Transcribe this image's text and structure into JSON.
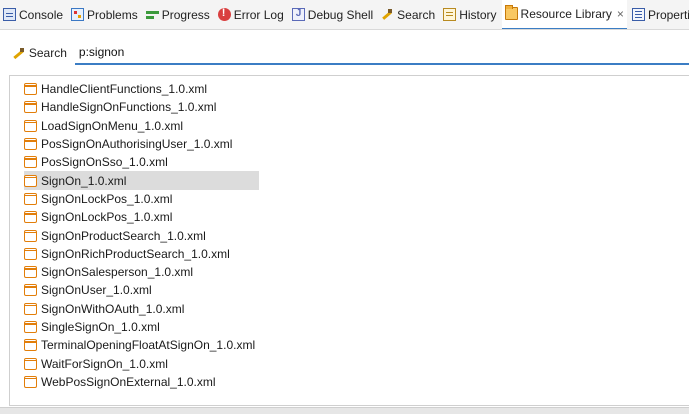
{
  "tabs": [
    {
      "label": "Console",
      "icon": "console-icon",
      "active": false
    },
    {
      "label": "Problems",
      "icon": "problems-icon",
      "active": false
    },
    {
      "label": "Progress",
      "icon": "progress-icon",
      "active": false
    },
    {
      "label": "Error Log",
      "icon": "error-log-icon",
      "active": false
    },
    {
      "label": "Debug Shell",
      "icon": "debug-shell-icon",
      "active": false
    },
    {
      "label": "Search",
      "icon": "search-icon",
      "active": false
    },
    {
      "label": "History",
      "icon": "history-icon",
      "active": false
    },
    {
      "label": "Resource Library",
      "icon": "resource-library-icon",
      "active": true,
      "close": "×"
    },
    {
      "label": "Properties",
      "icon": "properties-icon",
      "active": false
    }
  ],
  "search": {
    "label": "Search",
    "value": "p:signon"
  },
  "results": {
    "selected_index": 5,
    "items": [
      "HandleClientFunctions_1.0.xml",
      "HandleSignOnFunctions_1.0.xml",
      "LoadSignOnMenu_1.0.xml",
      "PosSignOnAuthorisingUser_1.0.xml",
      "PosSignOnSso_1.0.xml",
      "SignOn_1.0.xml",
      "SignOnLockPos_1.0.xml",
      "SignOnLockPos_1.0.xml",
      "SignOnProductSearch_1.0.xml",
      "SignOnRichProductSearch_1.0.xml",
      "SignOnSalesperson_1.0.xml",
      "SignOnUser_1.0.xml",
      "SignOnWithOAuth_1.0.xml",
      "SingleSignOn_1.0.xml",
      "TerminalOpeningFloatAtSignOn_1.0.xml",
      "WaitForSignOn_1.0.xml",
      "WebPosSignOnExternal_1.0.xml"
    ]
  },
  "colors": {
    "accent": "#3b7dc4",
    "file_icon": "#e27e0a",
    "selection": "#dcdcdc"
  }
}
